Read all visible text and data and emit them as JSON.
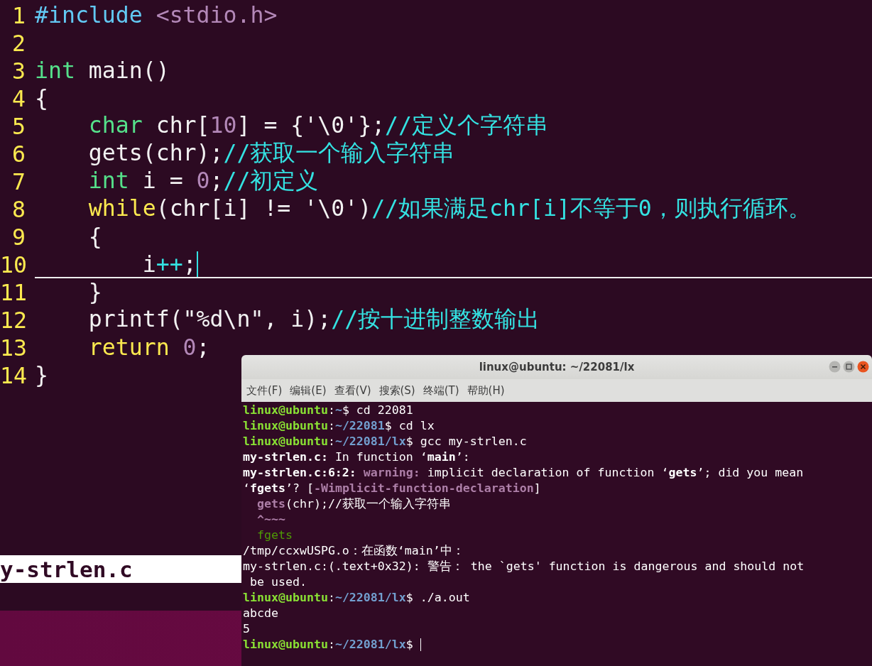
{
  "editor": {
    "lines": [
      {
        "number": "1",
        "current": false,
        "segments": [
          {
            "text": "#include",
            "kind": "preproc"
          },
          {
            "text": " <stdio.h>",
            "kind": "string"
          }
        ]
      },
      {
        "number": "2",
        "current": false
      },
      {
        "number": "3",
        "current": false,
        "segments": [
          {
            "text": "int",
            "kind": "type"
          },
          {
            "text": " main()",
            "kind": "plain"
          }
        ]
      },
      {
        "number": "4",
        "current": false,
        "segments": [
          {
            "text": "{",
            "kind": "plain"
          }
        ]
      },
      {
        "number": "5",
        "current": false,
        "segments": [
          {
            "text": "    char",
            "kind": "type"
          },
          {
            "text": " chr[",
            "kind": "plain"
          },
          {
            "text": "10",
            "kind": "number"
          },
          {
            "text": "] = {'\\0'};",
            "kind": "plain"
          },
          {
            "text": "//定义个字符串",
            "kind": "comment"
          }
        ]
      },
      {
        "number": "6",
        "current": false,
        "segments": [
          {
            "text": "    gets(chr);",
            "kind": "plain"
          },
          {
            "text": "//获取一个输入字符串",
            "kind": "comment"
          }
        ]
      },
      {
        "number": "7",
        "current": false,
        "segments": [
          {
            "text": "    int",
            "kind": "type"
          },
          {
            "text": " i = ",
            "kind": "plain"
          },
          {
            "text": "0",
            "kind": "number"
          },
          {
            "text": ";",
            "kind": "plain"
          },
          {
            "text": "//初定义",
            "kind": "comment"
          }
        ]
      },
      {
        "number": "8",
        "current": false,
        "segments": [
          {
            "text": "    while",
            "kind": "keyword"
          },
          {
            "text": "(chr[i] != '\\0')",
            "kind": "plain"
          },
          {
            "text": "//如果满足chr[i]不等于0，则执行循环。",
            "kind": "comment"
          }
        ]
      },
      {
        "number": "9",
        "current": false,
        "segments": [
          {
            "text": "    {",
            "kind": "plain"
          }
        ]
      },
      {
        "number": "10",
        "current": true,
        "segments": [
          {
            "text": "        i",
            "kind": "plain"
          },
          {
            "text": "++",
            "kind": "operator"
          },
          {
            "text": ";",
            "kind": "plain"
          }
        ]
      },
      {
        "number": "11",
        "current": false,
        "segments": [
          {
            "text": "    }",
            "kind": "plain"
          }
        ]
      },
      {
        "number": "12",
        "current": false,
        "segments": [
          {
            "text": "    printf(\"%d\\n\", i);",
            "kind": "plain"
          },
          {
            "text": "//按十进制整数输出",
            "kind": "comment"
          }
        ]
      },
      {
        "number": "13",
        "current": false,
        "segments": [
          {
            "text": "    return",
            "kind": "keyword"
          },
          {
            "text": " 0",
            "kind": "number"
          },
          {
            "text": ";",
            "kind": "plain"
          }
        ]
      },
      {
        "number": "14",
        "current": false,
        "segments": [
          {
            "text": "}",
            "kind": "plain"
          }
        ]
      }
    ],
    "status_bar": {
      "filename": "y-strlen.c"
    }
  },
  "terminal": {
    "title": "linux@ubuntu: ~/22081/lx",
    "menu": [
      "文件(F)",
      "编辑(E)",
      "查看(V)",
      "搜索(S)",
      "终端(T)",
      "帮助(H)"
    ],
    "lines": [
      [
        {
          "text": "linux@ubuntu",
          "kind": "user"
        },
        {
          "text": ":",
          "kind": "plain"
        },
        {
          "text": "~",
          "kind": "path"
        },
        {
          "text": "$ cd 22081",
          "kind": "plain"
        }
      ],
      [
        {
          "text": "linux@ubuntu",
          "kind": "user"
        },
        {
          "text": ":",
          "kind": "plain"
        },
        {
          "text": "~/22081",
          "kind": "path"
        },
        {
          "text": "$ cd lx",
          "kind": "plain"
        }
      ],
      [
        {
          "text": "linux@ubuntu",
          "kind": "user"
        },
        {
          "text": ":",
          "kind": "plain"
        },
        {
          "text": "~/22081/lx",
          "kind": "path"
        },
        {
          "text": "$ gcc my-strlen.c",
          "kind": "plain"
        }
      ],
      [
        {
          "text": "my-strlen.c:",
          "kind": "bold"
        },
        {
          "text": " In function ‘",
          "kind": "plain"
        },
        {
          "text": "main",
          "kind": "bold"
        },
        {
          "text": "’:",
          "kind": "plain"
        }
      ],
      [
        {
          "text": "my-strlen.c:6:2:",
          "kind": "bold"
        },
        {
          "text": " warning:",
          "kind": "warn"
        },
        {
          "text": " implicit declaration of function ‘",
          "kind": "plain"
        },
        {
          "text": "gets",
          "kind": "bold"
        },
        {
          "text": "’; did you mean",
          "kind": "plain"
        }
      ],
      [
        {
          "text": "‘",
          "kind": "plain"
        },
        {
          "text": "fgets",
          "kind": "bold"
        },
        {
          "text": "’? [",
          "kind": "plain"
        },
        {
          "text": "-Wimplicit-function-declaration",
          "kind": "warn"
        },
        {
          "text": "]",
          "kind": "plain"
        }
      ],
      [
        {
          "text": "  gets",
          "kind": "warn"
        },
        {
          "text": "(chr);//获取一个输入字符串",
          "kind": "plain"
        }
      ],
      [
        {
          "text": "  ^~~~",
          "kind": "warn"
        }
      ],
      [
        {
          "text": "  fgets",
          "kind": "hint"
        }
      ],
      [
        {
          "text": "/tmp/ccxwUSPG.o：在函数‘main’中：",
          "kind": "plain"
        }
      ],
      [
        {
          "text": "my-strlen.c:(.text+0x32): 警告： the `gets' function is dangerous and should not",
          "kind": "plain"
        }
      ],
      [
        {
          "text": " be used.",
          "kind": "plain"
        }
      ],
      [
        {
          "text": "linux@ubuntu",
          "kind": "user"
        },
        {
          "text": ":",
          "kind": "plain"
        },
        {
          "text": "~/22081/lx",
          "kind": "path"
        },
        {
          "text": "$ ./a.out",
          "kind": "plain"
        }
      ],
      [
        {
          "text": "abcde",
          "kind": "plain"
        }
      ],
      [
        {
          "text": "5",
          "kind": "plain"
        }
      ],
      [
        {
          "text": "linux@ubuntu",
          "kind": "user"
        },
        {
          "text": ":",
          "kind": "plain"
        },
        {
          "text": "~/22081/lx",
          "kind": "path"
        },
        {
          "text": "$",
          "kind": "plain"
        }
      ]
    ]
  }
}
